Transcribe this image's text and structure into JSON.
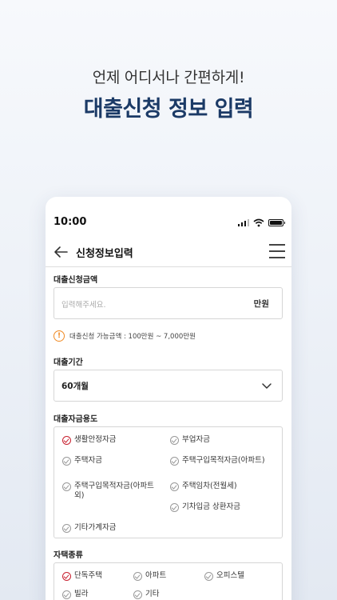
{
  "hero": {
    "subtitle": "언제 어디서나 간편하게!",
    "title": "대출신청 정보 입력"
  },
  "status_bar": {
    "time": "10:00"
  },
  "app_bar": {
    "title": "신청정보입력"
  },
  "loan_amount": {
    "label": "대출신청금액",
    "placeholder": "입력해주세요.",
    "unit": "만원",
    "notice": "대출신청 가능금액 : 100만원 ~ 7,000만원",
    "notice_icon": "!"
  },
  "loan_period": {
    "label": "대출기간",
    "selected": "60개월"
  },
  "loan_purpose": {
    "label": "대출자금용도",
    "options": [
      {
        "label": "생활안정자금",
        "checked": true
      },
      {
        "label": "부업자금",
        "checked": false
      },
      {
        "label": "주택자금",
        "checked": false
      },
      {
        "label": "주택구입목적자금(아파트)",
        "checked": false
      },
      {
        "label": "주택구입목적자금(아파트 외)",
        "checked": false
      },
      {
        "label": "주택임차(전월세)",
        "checked": false
      },
      {
        "label": "기차입금 상환자금",
        "checked": false
      },
      {
        "label": "기타가계자금",
        "checked": false
      }
    ]
  },
  "housing_type": {
    "label": "자택종류",
    "options": [
      {
        "label": "단독주택",
        "checked": true
      },
      {
        "label": "아파트",
        "checked": false
      },
      {
        "label": "오피스텔",
        "checked": false
      },
      {
        "label": "빌라",
        "checked": false
      },
      {
        "label": "기타",
        "checked": false
      }
    ]
  },
  "colors": {
    "accent_navy": "#1b3a66",
    "check_red": "#c8202f",
    "warning_orange": "#f08a24"
  }
}
